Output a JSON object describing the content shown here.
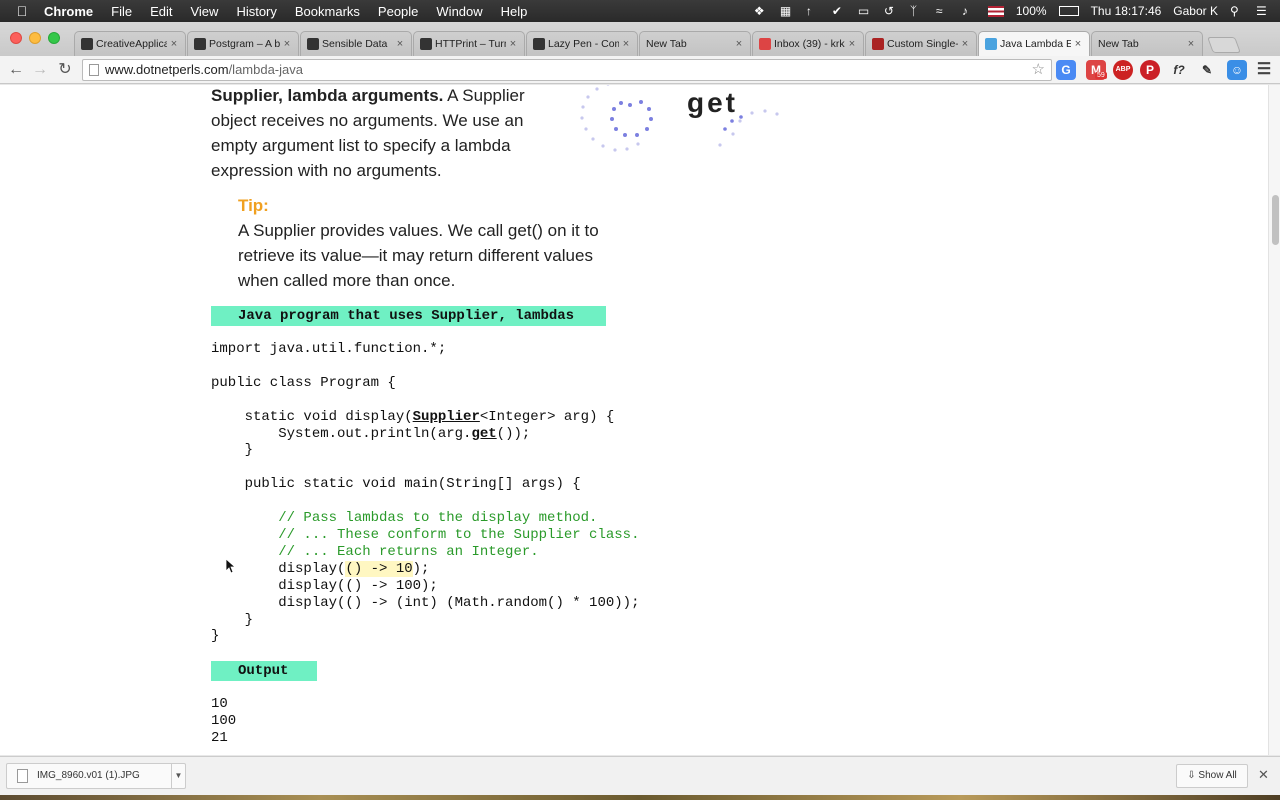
{
  "menubar": {
    "app_name": "Chrome",
    "menus": [
      "File",
      "Edit",
      "View",
      "History",
      "Bookmarks",
      "People",
      "Window",
      "Help"
    ],
    "battery": "100%",
    "clock": "Thu 18:17:46",
    "user": "Gabor K"
  },
  "tabs": [
    {
      "label": "CreativeApplica",
      "favicon": "creativeapplications-icon",
      "active": false
    },
    {
      "label": "Postgram – A b",
      "favicon": "postgram-icon",
      "active": false
    },
    {
      "label": "Sensible Data",
      "favicon": "sensible-data-icon",
      "active": false
    },
    {
      "label": "HTTPrint – Turn",
      "favicon": "httprint-icon",
      "active": false
    },
    {
      "label": "Lazy Pen - Com",
      "favicon": "lazy-pen-icon",
      "active": false
    },
    {
      "label": "New Tab",
      "favicon": "",
      "active": false
    },
    {
      "label": "Inbox (39) - krk",
      "favicon": "gmail-icon",
      "active": false
    },
    {
      "label": "Custom Single-",
      "favicon": "custom-single-icon",
      "active": false
    },
    {
      "label": "Java Lambda E",
      "favicon": "dotnetperls-icon",
      "active": true
    },
    {
      "label": "New Tab",
      "favicon": "",
      "active": false
    }
  ],
  "toolbar": {
    "url_domain": "www.dotnetperls.com",
    "url_path": "/lambda-java",
    "gmail_badge": "59",
    "abp_badge": "ABP"
  },
  "article": {
    "intro_bold": "Supplier, lambda arguments.",
    "intro_text": " A Supplier object receives no arguments. We use an empty argument list to specify a lambda expression with no arguments.",
    "deco_word": "get",
    "tip_label": "Tip:",
    "tip_text": "A Supplier provides values. We call get() on it to retrieve its value—it may return different values when called more than once.",
    "code_title": "Java program that uses Supplier, lambdas",
    "code": {
      "l1": "import java.util.function.*;",
      "l2": "public class Program {",
      "l3a": "    static void display(",
      "l3b": "Supplier",
      "l3c": "<Integer> arg) {",
      "l4a": "        System.out.println(arg.",
      "l4b": "get",
      "l4c": "());",
      "l5": "    }",
      "l6": "    public static void main(String[] args) {",
      "c1": "        // Pass lambdas to the display method.",
      "c2": "        // ... These conform to the Supplier class.",
      "c3": "        // ... Each returns an Integer.",
      "l7a": "        display(",
      "l7b": "() -> 10",
      "l7c": ");",
      "l8": "        display(() -> 100);",
      "l9": "        display(() -> (int) (Math.random() * 100));",
      "l10": "    }",
      "l11": "}"
    },
    "output_title": "Output",
    "output_lines": [
      "10",
      "100",
      "21"
    ]
  },
  "downloads": {
    "file_name": "IMG_8960.v01 (1).JPG",
    "show_all": "Show All"
  }
}
